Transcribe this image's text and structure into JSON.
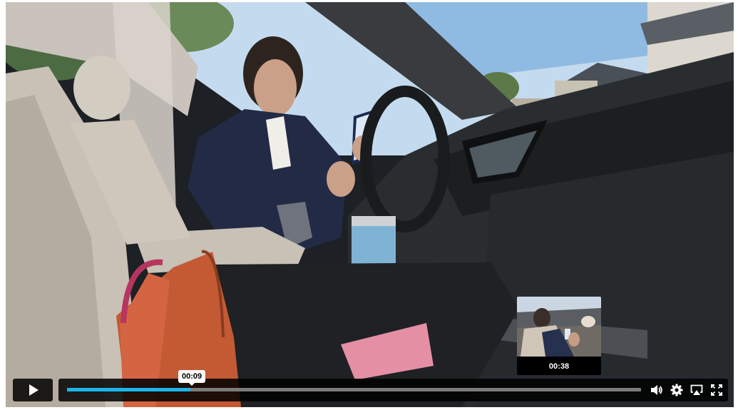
{
  "player": {
    "scrub_tooltip_time": "00:09",
    "preview_time": "00:38",
    "progress": 0.215,
    "accent_color": "#1ab7ea"
  },
  "controls": {
    "play_icon": "play-icon",
    "volume_icon": "volume-icon",
    "settings_icon": "gear-icon",
    "airplay_icon": "airplay-icon",
    "fullscreen_icon": "fullscreen-icon"
  }
}
